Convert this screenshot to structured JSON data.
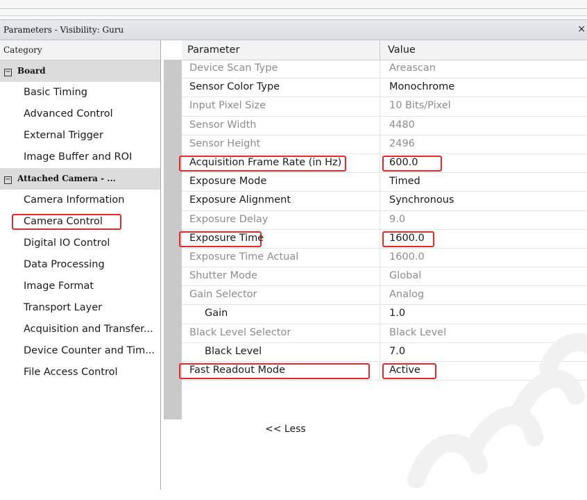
{
  "window": {
    "title": "Parameters - Visibility: Guru",
    "close_glyph": "×"
  },
  "category_panel": {
    "header": "Category",
    "groups": [
      {
        "label": "Board",
        "toggle": "−",
        "items": [
          "Basic Timing",
          "Advanced Control",
          "External Trigger",
          "Image Buffer and ROI"
        ]
      },
      {
        "label": "Attached Camera - ...",
        "toggle": "−",
        "items": [
          "Camera Information",
          "Camera Control",
          "Digital IO Control",
          "Data Processing",
          "Image Format",
          "Transport Layer",
          "Acquisition and Transfer...",
          "Device Counter and Tim...",
          "File Access Control"
        ]
      }
    ],
    "selected": "Camera Control"
  },
  "table": {
    "col_parameter": "Parameter",
    "col_value": "Value",
    "rows": [
      {
        "param": "Device Scan Type",
        "value": "Areascan"
      },
      {
        "param": "Sensor Color Type",
        "value": "Monochrome"
      },
      {
        "param": "Input Pixel Size",
        "value": "10 Bits/Pixel"
      },
      {
        "param": "Sensor Width",
        "value": "4480"
      },
      {
        "param": "Sensor Height",
        "value": "2496"
      },
      {
        "param": "Acquisition Frame Rate (in Hz)",
        "value": "600.0"
      },
      {
        "param": "Exposure Mode",
        "value": "Timed"
      },
      {
        "param": "Exposure Alignment",
        "value": "Synchronous"
      },
      {
        "param": "Exposure Delay",
        "value": "9.0"
      },
      {
        "param": "Exposure Time",
        "value": "1600.0"
      },
      {
        "param": "Exposure Time Actual",
        "value": "1600.0"
      },
      {
        "param": "Shutter Mode",
        "value": "Global"
      },
      {
        "param": "Gain Selector",
        "value": "Analog"
      },
      {
        "param": "Gain",
        "value": "1.0"
      },
      {
        "param": "Black Level Selector",
        "value": "Black Level"
      },
      {
        "param": "Black Level",
        "value": "7.0"
      },
      {
        "param": "Fast Readout Mode",
        "value": "Active"
      }
    ],
    "less_label": "<< Less"
  },
  "colors": {
    "highlight": "#e8262b",
    "readonly_text": "#8c8c8c",
    "watermark": "#f2f2f2"
  }
}
